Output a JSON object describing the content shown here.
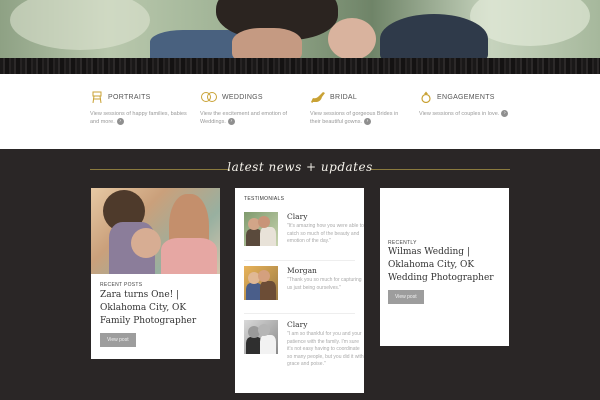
{
  "services": [
    {
      "icon": "highchair-icon",
      "title": "PORTRAITS",
      "desc": "View sessions of happy families, babies and more."
    },
    {
      "icon": "rings-icon",
      "title": "WEDDINGS",
      "desc": "View the excitement and emotion of Weddings."
    },
    {
      "icon": "shoe-icon",
      "title": "BRIDAL",
      "desc": "View sessions of gorgeous Brides in their beautiful gowns."
    },
    {
      "icon": "ring-icon",
      "title": "ENGAGEMENTS",
      "desc": "View sessions of couples in love."
    }
  ],
  "services_arrow": "›",
  "news": {
    "title": "latest news + updates"
  },
  "recent_posts": {
    "label": "RECENT POSTS",
    "title": "Zara turns One! | Oklahoma City, OK Family Photographer",
    "button": "View post"
  },
  "testimonials": {
    "label": "TESTIMONIALS",
    "items": [
      {
        "name": "Clary",
        "text": "\"It's amazing how you were able to catch so much of the beauty and emotion of the day.\""
      },
      {
        "name": "Morgan",
        "text": "\"Thank you so much for capturing us just being ourselves.\""
      },
      {
        "name": "Clary",
        "text": "\"I am so thankful for you and your patience with the family. I'm sure it's not easy having to coordinate so many people, but you did it with grace and poise.\""
      }
    ]
  },
  "recently": {
    "label": "RECENTLY",
    "title": "Wilmas Wedding | Oklahoma City, OK Wedding Photographer",
    "button": "View post"
  },
  "colors": {
    "accent_gold": "#c9a235",
    "dark_bg": "#2a2626",
    "button_grey": "#9d9d9d"
  }
}
